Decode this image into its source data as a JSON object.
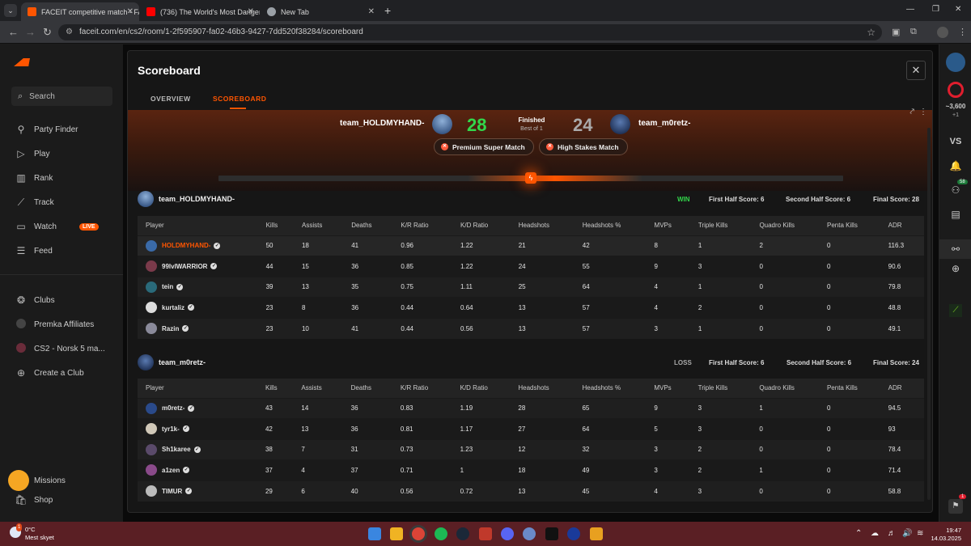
{
  "browser": {
    "tabs": [
      {
        "title": "FACEIT competitive match - FA",
        "favicon_color": "#ff5500"
      },
      {
        "title": "(736) The World's Most Danger",
        "favicon_color": "#ff0000"
      },
      {
        "title": "New Tab",
        "favicon_color": "#9aa0a6"
      }
    ],
    "url": "faceit.com/en/cs2/room/1-2f595907-fa02-46b3-9427-7dd520f38284/scoreboard"
  },
  "sidebar": {
    "search_label": "Search",
    "items": [
      {
        "label": "Party Finder",
        "icon": "party-finder-icon"
      },
      {
        "label": "Play",
        "icon": "play-icon"
      },
      {
        "label": "Rank",
        "icon": "rank-icon"
      },
      {
        "label": "Track",
        "icon": "track-icon"
      },
      {
        "label": "Watch",
        "icon": "watch-icon",
        "badge": "LIVE"
      },
      {
        "label": "Feed",
        "icon": "feed-icon"
      }
    ],
    "clubs": [
      {
        "label": "Clubs"
      },
      {
        "label": "Premka Affiliates"
      },
      {
        "label": "CS2 - Norsk 5 ma..."
      },
      {
        "label": "Create a Club"
      }
    ],
    "bottom": [
      {
        "label": "Missions"
      },
      {
        "label": "Shop"
      }
    ]
  },
  "rail": {
    "elo": "~3,600",
    "elo_delta": "+1",
    "vs": "VS",
    "friends_count": "58",
    "notif_count": "1"
  },
  "modal": {
    "title": "Scoreboard",
    "tabs": [
      "OVERVIEW",
      "SCOREBOARD"
    ],
    "hero": {
      "team1": "team_HOLDMYHAND-",
      "team2": "team_m0retz-",
      "score1": "28",
      "score2": "24",
      "status": "Finished",
      "best_of": "Best of 1",
      "badges": [
        "Premium Super Match",
        "High Stakes Match"
      ]
    },
    "columns1": [
      "Player",
      "Kills",
      "Assists",
      "Deaths",
      "K/R Ratio",
      "K/D Ratio",
      "Headshots",
      "Headshots %",
      "MVPs",
      "Triple Kills",
      "Quadro Kills",
      "Penta Kills",
      "ADR"
    ],
    "team1": {
      "name": "team_HOLDMYHAND-",
      "result": "WIN",
      "first_half": "First Half Score: 6",
      "second_half": "Second Half Score: 6",
      "final": "Final Score: 28",
      "players": [
        [
          "HOLDMYHAND-",
          "50",
          "18",
          "41",
          "0.96",
          "1.22",
          "21",
          "42",
          "8",
          "1",
          "2",
          "0",
          "116.3"
        ],
        [
          "99lvlWARRIOR",
          "44",
          "15",
          "36",
          "0.85",
          "1.22",
          "24",
          "55",
          "9",
          "3",
          "0",
          "0",
          "90.6"
        ],
        [
          "tein",
          "39",
          "13",
          "35",
          "0.75",
          "1.11",
          "25",
          "64",
          "4",
          "1",
          "0",
          "0",
          "79.8"
        ],
        [
          "kurtaliz",
          "23",
          "8",
          "36",
          "0.44",
          "0.64",
          "13",
          "57",
          "4",
          "2",
          "0",
          "0",
          "48.8"
        ],
        [
          "Razin",
          "23",
          "10",
          "41",
          "0.44",
          "0.56",
          "13",
          "57",
          "3",
          "1",
          "0",
          "0",
          "49.1"
        ]
      ]
    },
    "team2": {
      "name": "team_m0retz-",
      "result": "LOSS",
      "first_half": "First Half Score: 6",
      "second_half": "Second Half Score: 6",
      "final": "Final Score: 24",
      "players": [
        [
          "m0retz-",
          "43",
          "14",
          "36",
          "0.83",
          "1.19",
          "28",
          "65",
          "9",
          "3",
          "1",
          "0",
          "94.5"
        ],
        [
          "tyr1k-",
          "42",
          "13",
          "36",
          "0.81",
          "1.17",
          "27",
          "64",
          "5",
          "3",
          "0",
          "0",
          "93"
        ],
        [
          "Sh1karee",
          "38",
          "7",
          "31",
          "0.73",
          "1.23",
          "12",
          "32",
          "3",
          "2",
          "0",
          "0",
          "78.4"
        ],
        [
          "a1zen",
          "37",
          "4",
          "37",
          "0.71",
          "1",
          "18",
          "49",
          "3",
          "2",
          "1",
          "0",
          "71.4"
        ],
        [
          "TIMUR",
          "29",
          "6",
          "40",
          "0.56",
          "0.72",
          "13",
          "45",
          "4",
          "3",
          "0",
          "0",
          "58.8"
        ]
      ]
    }
  },
  "taskbar": {
    "temp": "0°C",
    "weather": "Mest skyet",
    "time": "19:47",
    "date": "14.03.2025",
    "weather_badge": "1"
  },
  "colors": {
    "accent": "#ff5500",
    "win": "#32d74b",
    "loss": "#aaaaaa"
  }
}
